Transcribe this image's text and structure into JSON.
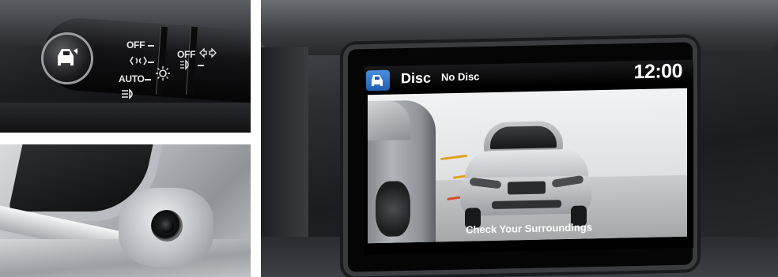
{
  "stalk_panel": {
    "labels": {
      "off_top": "OFF",
      "auto": "AUTO",
      "off_side": "OFF"
    },
    "icons": [
      "lanewatch-car-icon",
      "parking-lights-icon",
      "headlight-icon",
      "high-beam-icon",
      "fog-light-icon",
      "turn-signal-arrows-icon"
    ]
  },
  "camera_panel": {
    "icons": [
      "side-mirror-camera-icon"
    ]
  },
  "display": {
    "source_label": "Disc",
    "source_status": "No Disc",
    "clock": "12:00",
    "caption": "Check Your Surroundings",
    "accent_color": "#2f6fc8",
    "guide_colors": [
      "#d84a2a",
      "#e0a020"
    ]
  }
}
